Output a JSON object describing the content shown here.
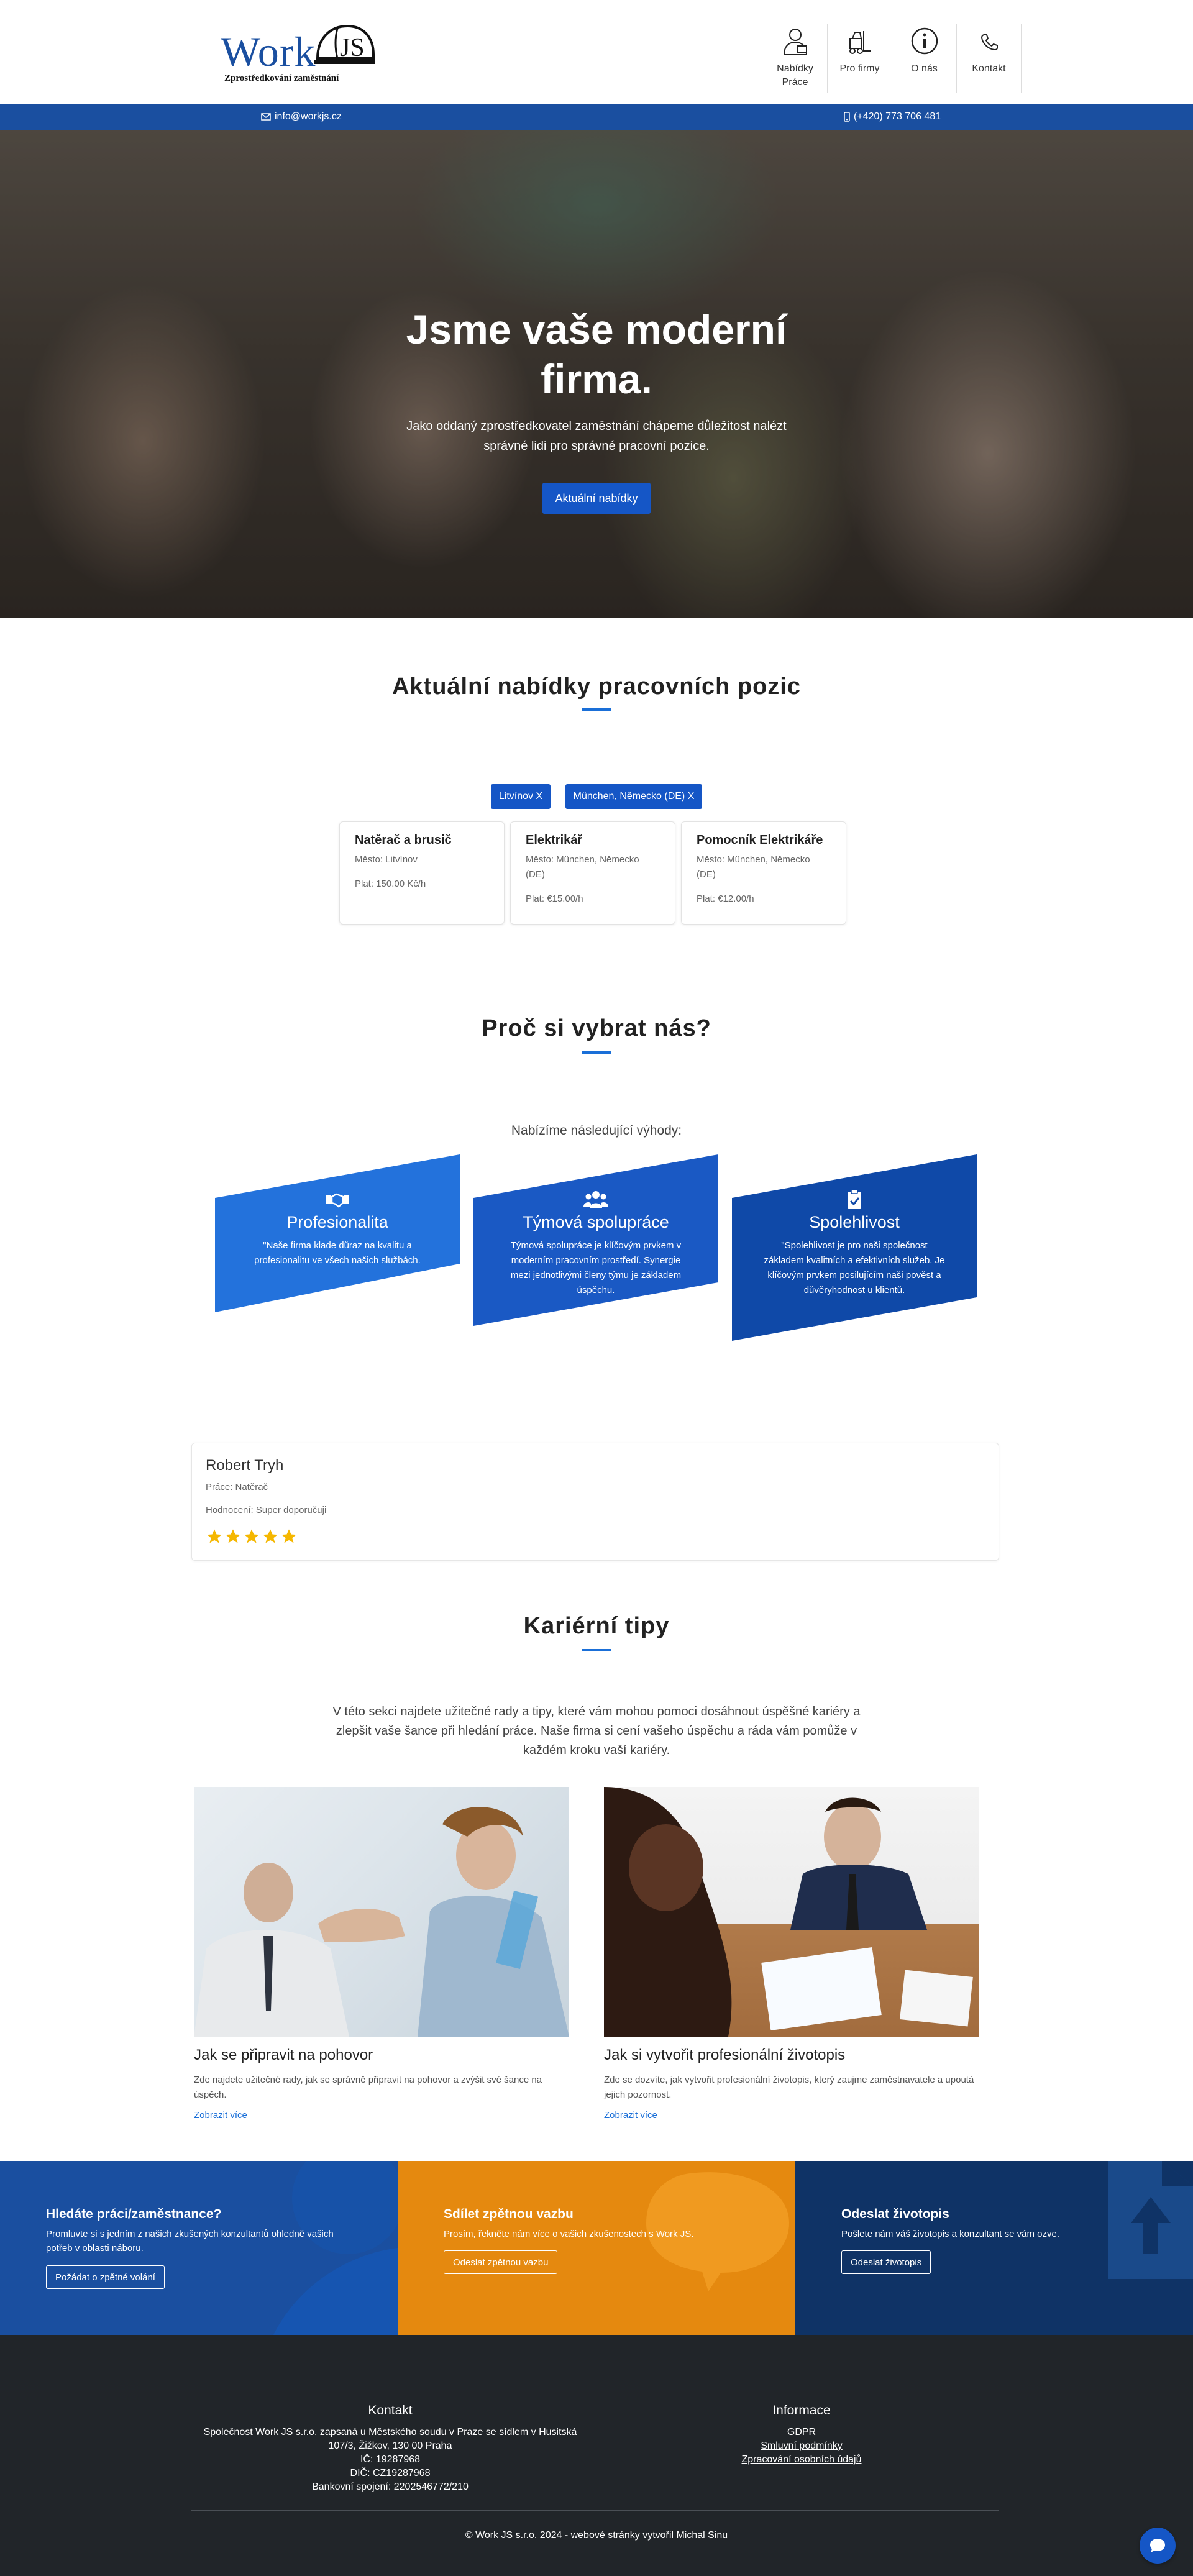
{
  "brand": {
    "logo_text": "Work",
    "logo_js": "JS",
    "tagline": "Zprostředkování zaměstnání"
  },
  "nav": [
    {
      "label": "Nabídky Práce",
      "icon": "job-seeker-icon"
    },
    {
      "label": "Pro firmy",
      "icon": "forklift-icon"
    },
    {
      "label": "O nás",
      "icon": "info-icon"
    },
    {
      "label": "Kontakt",
      "icon": "phone-icon"
    }
  ],
  "infobar": {
    "email": "info@workjs.cz",
    "phone": "(+420) 773 706 481"
  },
  "hero": {
    "title": "Jsme vaše moderní firma.",
    "text": "Jako oddaný zprostředkovatel zaměstnání chápeme důležitost nalézt správné lidi pro správné pracovní pozice.",
    "button": "Aktuální nabídky"
  },
  "offers": {
    "title": "Aktuální nabídky pracovních pozic",
    "filters": [
      "Litvínov X",
      "München, Německo (DE) X"
    ],
    "jobs": [
      {
        "title": "Natěrač a brusič",
        "city": "Město: Litvínov",
        "pay": "Plat: 150.00 Kč/h"
      },
      {
        "title": "Elektrikář",
        "city": "Město: München, Německo (DE)",
        "pay": "Plat: €15.00/h"
      },
      {
        "title": "Pomocník Elektrikáře",
        "city": "Město: München, Německo (DE)",
        "pay": "Plat: €12.00/h"
      }
    ]
  },
  "why": {
    "title": "Proč si vybrat nás?",
    "subtitle": "Nabízíme následující výhody:",
    "cards": [
      {
        "title": "Profesionalita",
        "text": "\"Naše firma klade důraz na kvalitu a profesionalitu ve všech našich službách.",
        "icon": "handshake-icon"
      },
      {
        "title": "Týmová spolupráce",
        "text": "Týmová spolupráce je klíčovým prvkem v moderním pracovním prostředí. Synergie mezi jednotlivými členy týmu je základem úspěchu.",
        "icon": "team-icon"
      },
      {
        "title": "Spolehlivost",
        "text": "\"Spolehlivost je pro naši společnost základem kvalitních a efektivních služeb. Je klíčovým prvkem posilujícím naši pověst a důvěryhodnost u klientů.",
        "icon": "clipboard-check-icon"
      }
    ]
  },
  "testimonial": {
    "name": "Robert Tryh",
    "job": "Práce: Natěrač",
    "rating_text": "Hodnocení: Super doporučuji",
    "stars": 5
  },
  "tips": {
    "title": "Kariérní tipy",
    "intro": "V této sekci najdete užitečné rady a tipy, které vám mohou pomoci dosáhnout úspěšné kariéry a zlepšit vaše šance při hledání práce. Naše firma si cení vašeho úspěchu a ráda vám pomůže v každém kroku vaší kariéry.",
    "items": [
      {
        "title": "Jak se připravit na pohovor",
        "text": "Zde najdete užitečné rady, jak se správně připravit na pohovor a zvýšit své šance na úspěch.",
        "link": "Zobrazit více"
      },
      {
        "title": "Jak si vytvořit profesionální životopis",
        "text": "Zde se dozvíte, jak vytvořit profesionální životopis, který zaujme zaměstnavatele a upoutá jejich pozornost.",
        "link": "Zobrazit více"
      }
    ]
  },
  "cta": [
    {
      "title": "Hledáte práci/zaměstnance?",
      "text": "Promluvte si s jedním z našich zkušených konzultantů ohledně vašich potřeb v oblasti náboru.",
      "button": "Požádat o zpětné volání",
      "color": "#1a4fa0"
    },
    {
      "title": "Sdílet zpětnou vazbu",
      "text": "Prosím, řekněte nám více o vašich zkušenostech s Work JS.",
      "button": "Odeslat zpětnou vazbu",
      "color": "#e5890f"
    },
    {
      "title": "Odeslat životopis",
      "text": "Pošlete nám váš životopis a konzultant se vám ozve.",
      "button": "Odeslat životopis",
      "color": "#0f3366"
    }
  ],
  "footer": {
    "contact_title": "Kontakt",
    "contact_lines": [
      "Společnost Work JS s.r.o. zapsaná u Městského soudu v Praze se sídlem v Husitská",
      "107/3, Žižkov, 130 00 Praha",
      "IČ: 19287968",
      "DIČ: CZ19287968",
      "Bankovní spojení: 2202546772/210"
    ],
    "info_title": "Informace",
    "info_links": [
      "GDPR",
      "Smluvní podmínky",
      "Zpracování osobních údajů"
    ],
    "copyright": "© Work JS s.r.o. 2024 - webové stránky vytvořil",
    "author": "Michal Sinu"
  }
}
